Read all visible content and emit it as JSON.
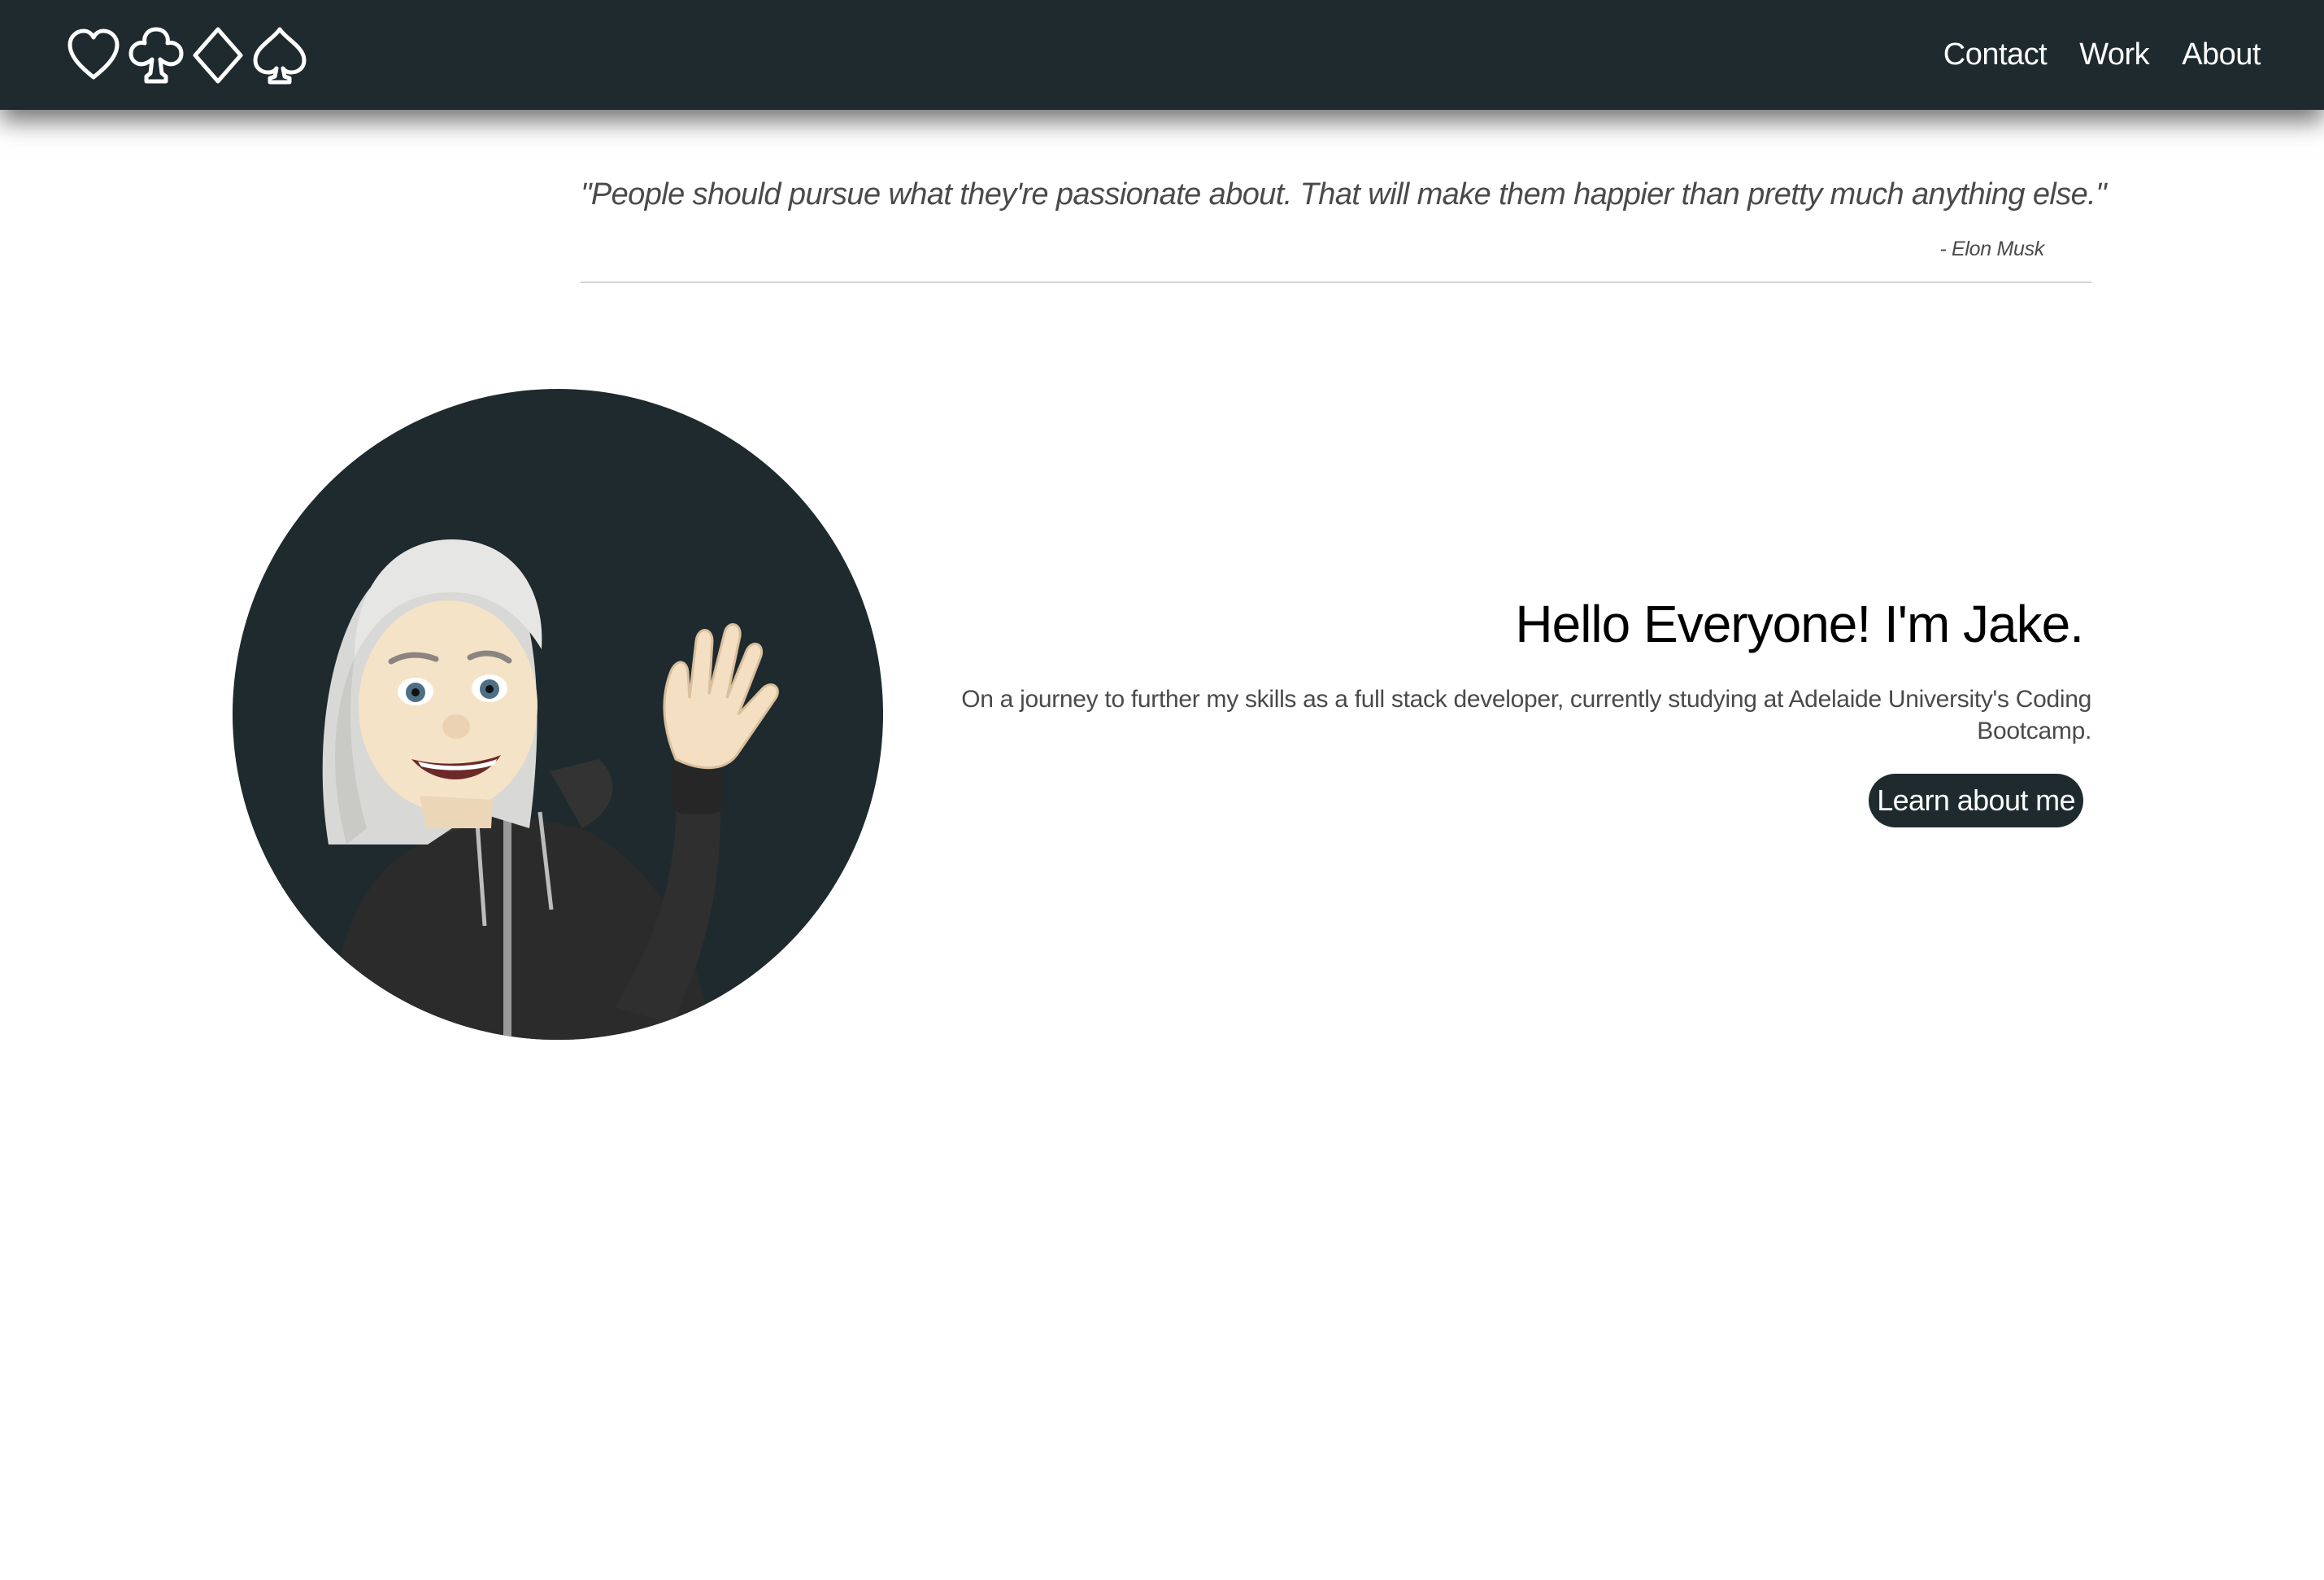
{
  "navbar": {
    "logo_icons": [
      "heart-outline-icon",
      "club-outline-icon",
      "diamond-outline-icon",
      "spade-outline-icon"
    ],
    "links": [
      {
        "label": "Contact"
      },
      {
        "label": "Work"
      },
      {
        "label": "About"
      }
    ]
  },
  "quote": {
    "text": "\"People should pursue what they're passionate about. That will make them happier than pretty much anything else.\"",
    "author": "- Elon Musk"
  },
  "hero": {
    "avatar_icon": "memoji-waving-avatar",
    "title": "Hello Everyone! I'm Jake.",
    "description": "On a journey to further my skills as a full stack developer, currently studying at Adelaide University's Coding Bootcamp.",
    "button_label": "Learn about me"
  },
  "colors": {
    "nav_background": "#1e2a2e",
    "nav_text": "#ffffff",
    "button_background": "#1e2a2e",
    "quote_text": "#4a4a4a",
    "divider": "#d3d3d3"
  }
}
